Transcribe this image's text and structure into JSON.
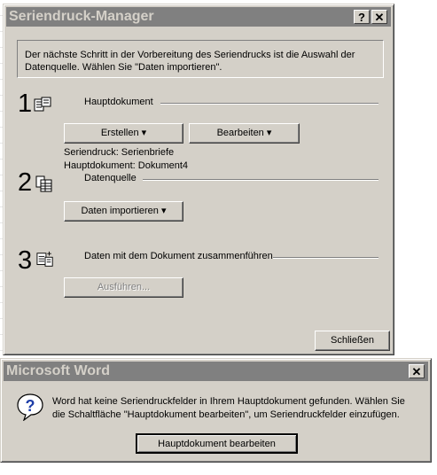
{
  "manager": {
    "title": "Seriendruck-Manager",
    "help_label": "?",
    "close_label": "✕",
    "info_text": "Der nächste Schritt in der Vorbereitung des Seriendrucks ist die Auswahl der Datenquelle. Wählen Sie \"Daten importieren\".",
    "step1": {
      "number": "1",
      "heading": "Hauptdokument",
      "create_button": "Erstellen ▾",
      "edit_button": "Bearbeiten ▾",
      "status_line1": "Seriendruck: Serienbriefe",
      "status_line2": "Hauptdokument: Dokument4"
    },
    "step2": {
      "number": "2",
      "heading": "Datenquelle",
      "import_button": "Daten importieren ▾"
    },
    "step3": {
      "number": "3",
      "heading": "Daten mit dem Dokument zusammenführen",
      "run_button": "Ausführen..."
    },
    "close_button": "Schließen"
  },
  "msgbox": {
    "title": "Microsoft Word",
    "close_label": "✕",
    "icon": "question-icon",
    "message": "Word hat keine Seriendruckfelder in Ihrem Hauptdokument gefunden. Wählen Sie die Schaltfläche \"Hauptdokument bearbeiten\", um Seriendruckfelder einzufügen.",
    "edit_main_doc_button": "Hauptdokument bearbeiten"
  }
}
